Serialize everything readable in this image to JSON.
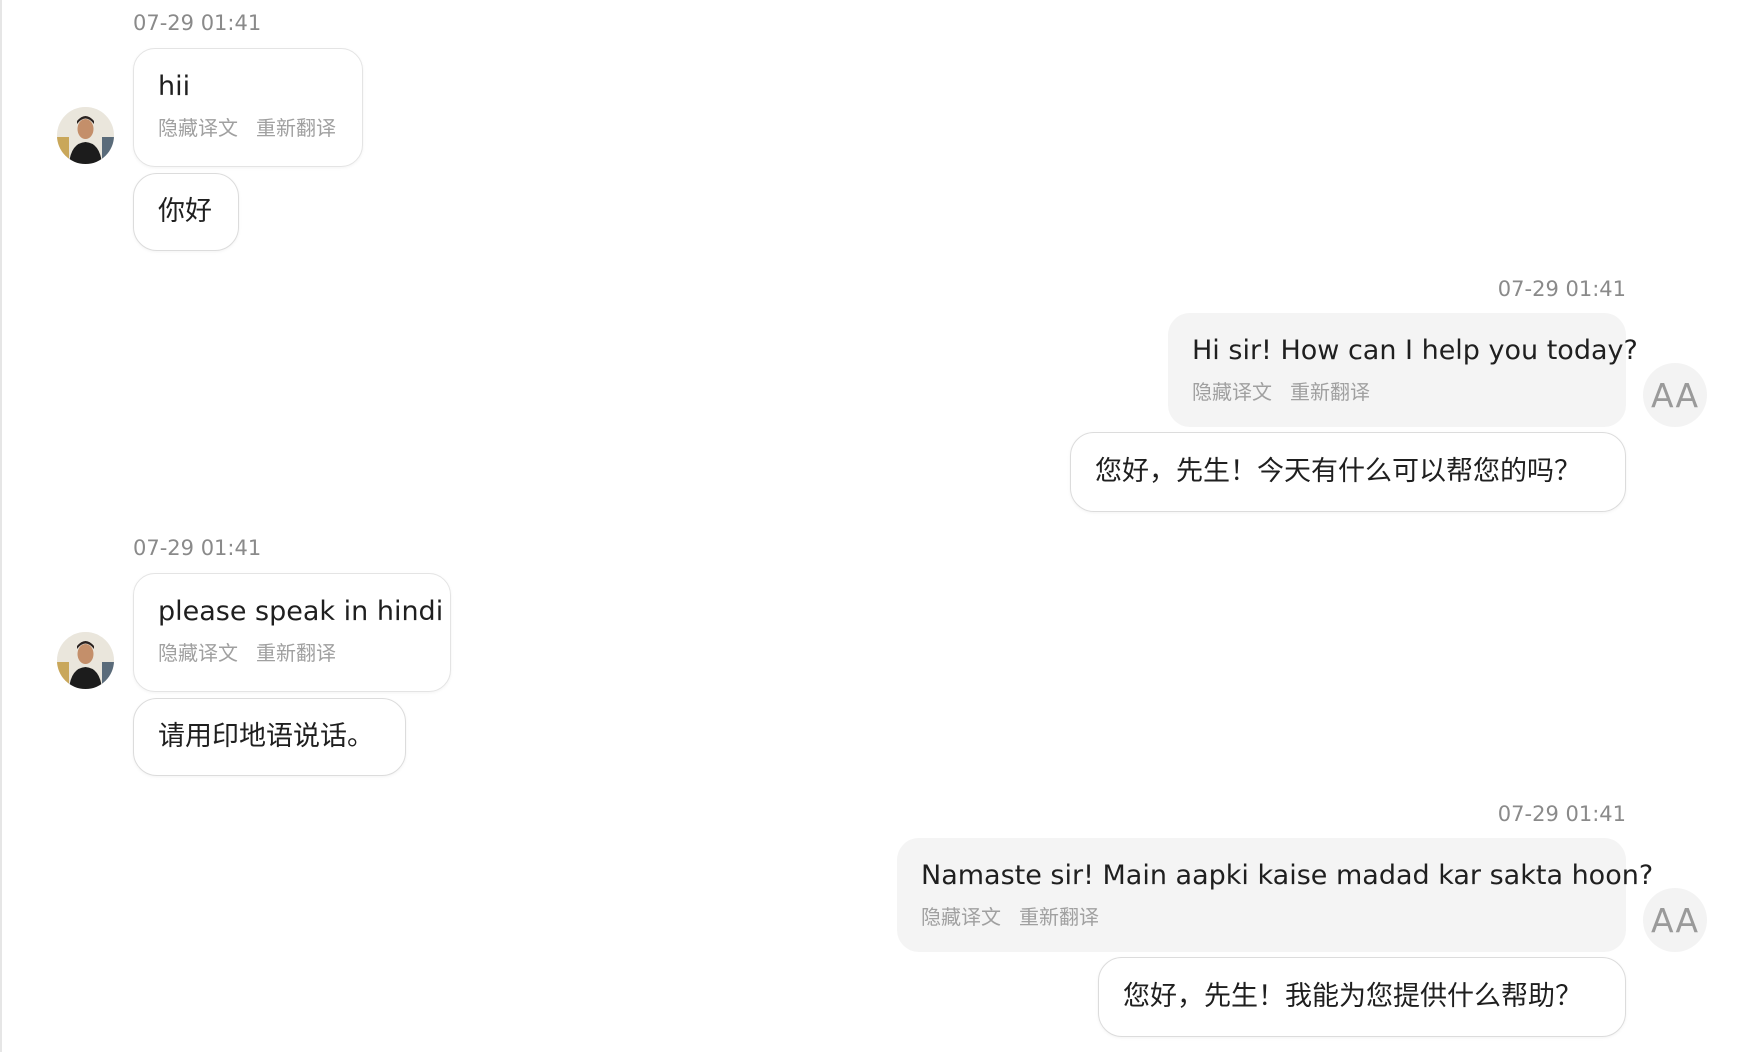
{
  "messages": [
    {
      "time": "07-29 01:41",
      "text": "hii",
      "hide_label": "隐藏译文",
      "retranslate_label": "重新翻译",
      "translation": "你好"
    },
    {
      "time": "07-29 01:41",
      "text": "Hi sir! How can I help you today?",
      "hide_label": "隐藏译文",
      "retranslate_label": "重新翻译",
      "translation": "您好，先生！今天有什么可以帮您的吗？",
      "avatar_initials": "AA"
    },
    {
      "time": "07-29 01:41",
      "text": "please speak in hindi",
      "hide_label": "隐藏译文",
      "retranslate_label": "重新翻译",
      "translation": "请用印地语说话。"
    },
    {
      "time": "07-29 01:41",
      "text": "Namaste sir! Main aapki kaise madad kar sakta hoon?",
      "hide_label": "隐藏译文",
      "retranslate_label": "重新翻译",
      "translation": "您好，先生！我能为您提供什么帮助？",
      "avatar_initials": "AA"
    }
  ],
  "colors": {
    "outgoing_bubble": "#f4f4f4",
    "incoming_bubble": "#ffffff",
    "muted_text": "#a0a0a0",
    "timestamp": "#8a8a8a"
  }
}
